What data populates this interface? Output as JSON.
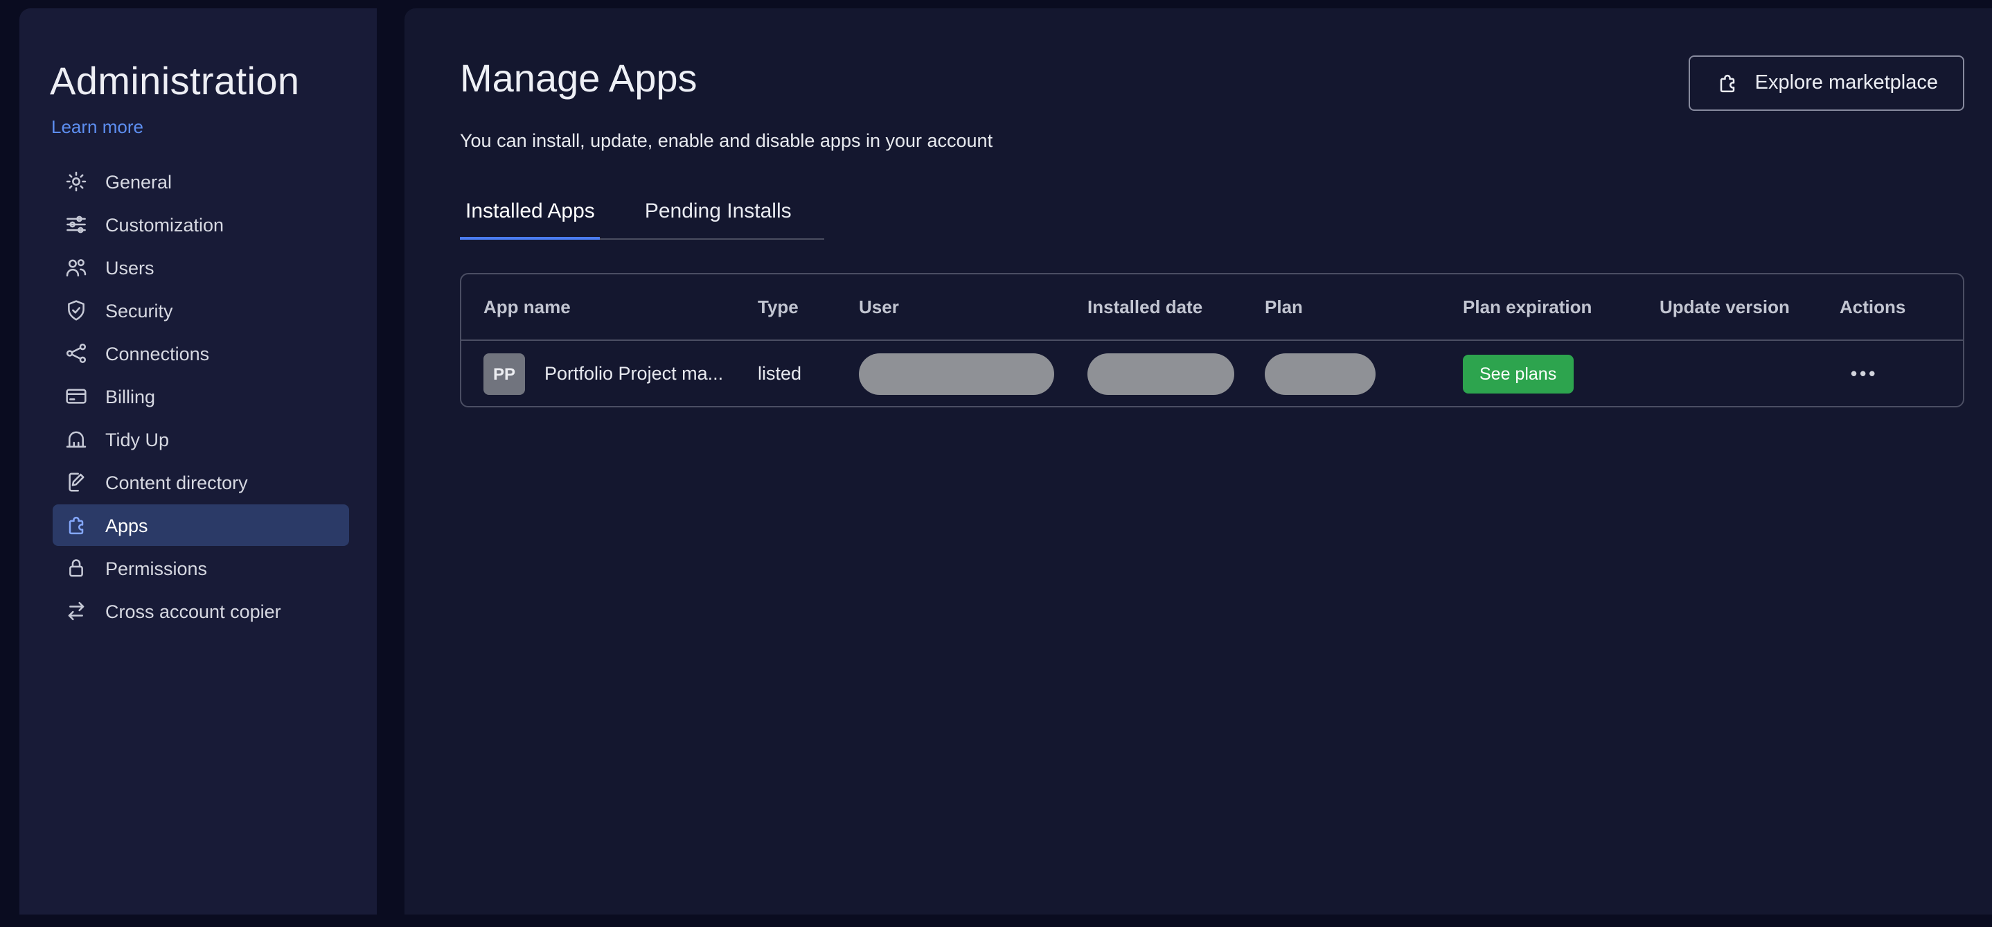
{
  "sidebar": {
    "title": "Administration",
    "learn_more_label": "Learn more",
    "items": [
      {
        "label": "General",
        "icon": "gear-icon",
        "selected": false
      },
      {
        "label": "Customization",
        "icon": "sliders-icon",
        "selected": false
      },
      {
        "label": "Users",
        "icon": "users-icon",
        "selected": false
      },
      {
        "label": "Security",
        "icon": "shield-icon",
        "selected": false
      },
      {
        "label": "Connections",
        "icon": "connections-icon",
        "selected": false
      },
      {
        "label": "Billing",
        "icon": "credit-card-icon",
        "selected": false
      },
      {
        "label": "Tidy Up",
        "icon": "tidy-up-icon",
        "selected": false
      },
      {
        "label": "Content directory",
        "icon": "document-edit-icon",
        "selected": false
      },
      {
        "label": "Apps",
        "icon": "puzzle-icon",
        "selected": true
      },
      {
        "label": "Permissions",
        "icon": "lock-icon",
        "selected": false
      },
      {
        "label": "Cross account copier",
        "icon": "transfer-arrows-icon",
        "selected": false
      }
    ]
  },
  "main": {
    "title": "Manage Apps",
    "subtitle": "You can install, update, enable and disable apps in your account",
    "explore_button_label": "Explore marketplace",
    "tabs": [
      {
        "label": "Installed Apps",
        "active": true
      },
      {
        "label": "Pending Installs",
        "active": false
      }
    ],
    "table": {
      "columns": [
        "App name",
        "Type",
        "User",
        "Installed date",
        "Plan",
        "Plan expiration",
        "Update version",
        "Actions"
      ],
      "rows": [
        {
          "avatar_text": "PP",
          "app_name": "Portfolio Project ma...",
          "type": "listed",
          "user_redacted": true,
          "installed_date_redacted": true,
          "plan_redacted": true,
          "plan_expiration_action": "See plans",
          "update_version": "",
          "actions_menu": "•••"
        }
      ]
    }
  },
  "colors": {
    "accent_blue": "#4b7cf0",
    "link_blue": "#5d8ef0",
    "green_button": "#2da44e",
    "selected_item_bg": "#2b3a67",
    "redaction_grey": "#8f9196",
    "sidebar_bg": "#181b37",
    "main_bg": "#14172f"
  }
}
